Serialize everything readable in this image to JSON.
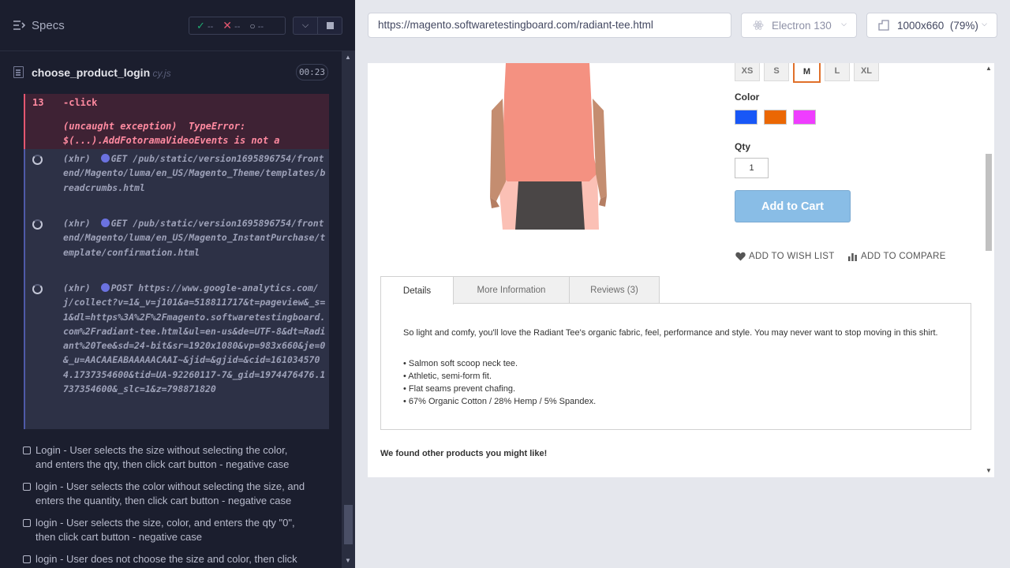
{
  "reporter": {
    "title": "Specs",
    "stats": {
      "passed": "--",
      "failed": "--",
      "pending": "--"
    },
    "spec": {
      "name": "choose_product_login",
      "ext": " cy.js",
      "time": "00:23"
    },
    "error": {
      "line": "13",
      "command": "-click",
      "prefix": "(uncaught exception)",
      "type": "TypeError:",
      "message": "$(...).AddFotoramaVideoEvents is not a function"
    },
    "xhr": [
      {
        "label": "(xhr)",
        "method": "GET",
        "url": "/pub/static/version1695896754/frontend/Magento/luma/en_US/Magento_Theme/templates/breadcrumbs.html"
      },
      {
        "label": "(xhr)",
        "method": "GET",
        "url": "/pub/static/version1695896754/frontend/Magento/luma/en_US/Magento_InstantPurchase/template/confirmation.html"
      },
      {
        "label": "(xhr)",
        "method": "POST",
        "url": "https://www.google-analytics.com/j/collect?v=1&_v=j101&a=518811717&t=pageview&_s=1&dl=https%3A%2F%2Fmagento.softwaretestingboard.com%2Fradiant-tee.html&ul=en-us&de=UTF-8&dt=Radiant%20Tee&sd=24-bit&sr=1920x1080&vp=983x660&je=0&_u=AACAAEABAAAAACAAI~&jid=&gjid=&cid=1610345704.1737354600&tid=UA-92260117-7&_gid=1974476476.1737354600&_slc=1&z=798871820"
      }
    ],
    "tests": [
      "Login - User selects the size without selecting the color, and enters the qty, then click cart button - negative case",
      "login - User selects the color without selecting the size, and enters the quantity, then click cart button - negative case",
      "login - User selects the size, color, and enters the qty \"0\", then click cart button - negative case",
      "login - User does not choose the size and color, then click cart"
    ]
  },
  "aut": {
    "url": "https://magento.softwaretestingboard.com/radiant-tee.html",
    "browser": "Electron 130",
    "viewport": "1000x660",
    "zoom": "(79%)"
  },
  "product": {
    "sizes": [
      "XS",
      "S",
      "M",
      "L",
      "XL"
    ],
    "selected_size": "M",
    "color_label": "Color",
    "swatches": [
      "#1857f7",
      "#eb6703",
      "#ef3dff"
    ],
    "qty_label": "Qty",
    "qty": "1",
    "add_to_cart": "Add to Cart",
    "wish": "ADD TO WISH LIST",
    "compare": "ADD TO COMPARE",
    "tabs": [
      "Details",
      "More Information",
      "Reviews (3)"
    ],
    "description": "So light and comfy, you'll love the Radiant Tee's organic fabric, feel, performance and style. You may never want to stop moving in this shirt.",
    "bullets": [
      "• Salmon soft scoop neck tee.",
      "• Athletic, semi-form fit.",
      "• Flat seams prevent chafing.",
      "• 67% Organic Cotton / 28% Hemp / 5% Spandex."
    ],
    "related": "We found other products you might like!"
  }
}
